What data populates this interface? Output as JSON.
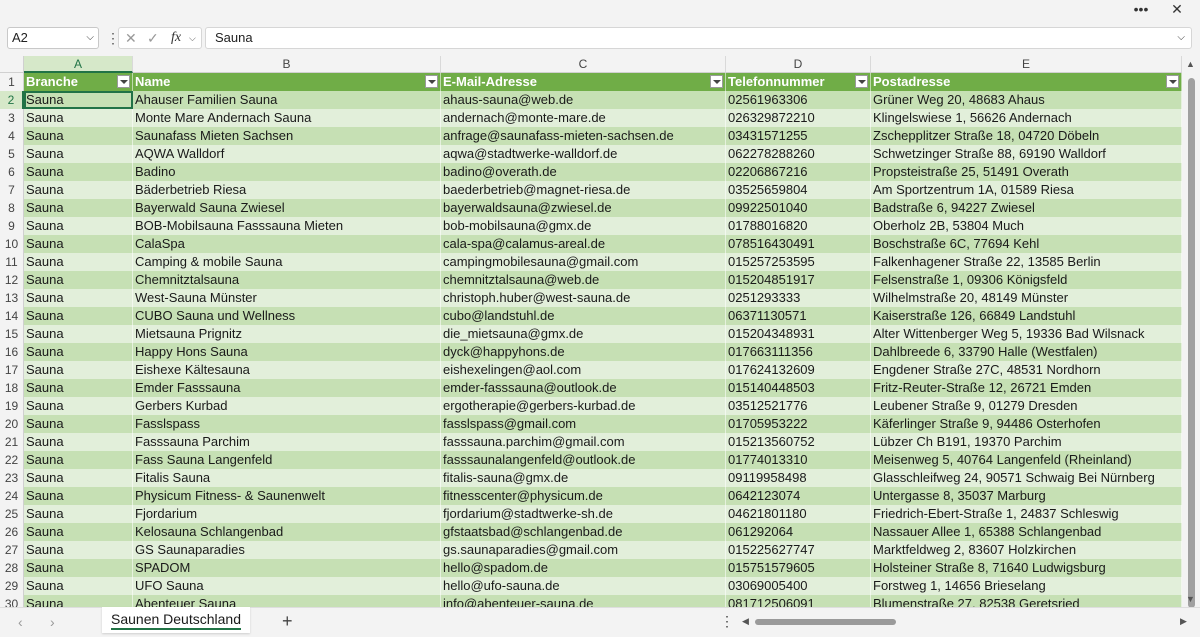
{
  "window": {
    "more_label": "•••",
    "close_label": "✕"
  },
  "formula_bar": {
    "name_box": "A2",
    "formula": "Sauna",
    "cancel_glyph": "✕",
    "enter_glyph": "✓",
    "fx_label": "fx"
  },
  "columns": [
    "A",
    "B",
    "C",
    "D",
    "E"
  ],
  "headers": [
    "Branche",
    "Name",
    "E-Mail-Adresse",
    "Telefonnummer",
    "Postadresse"
  ],
  "rows": [
    {
      "n": "2",
      "c": [
        "Sauna",
        "Ahauser Familien Sauna",
        "ahaus-sauna@web.de",
        "02561963306",
        "Grüner Weg 20, 48683 Ahaus"
      ]
    },
    {
      "n": "3",
      "c": [
        "Sauna",
        "Monte Mare Andernach Sauna",
        "andernach@monte-mare.de",
        "026329872210",
        "Klingelswiese 1, 56626 Andernach"
      ]
    },
    {
      "n": "4",
      "c": [
        "Sauna",
        "Saunafass Mieten Sachsen",
        "anfrage@saunafass-mieten-sachsen.de",
        "03431571255",
        "Zschepplitzer Straße 18, 04720 Döbeln"
      ]
    },
    {
      "n": "5",
      "c": [
        "Sauna",
        "AQWA Walldorf",
        "aqwa@stadtwerke-walldorf.de",
        "062278288260",
        "Schwetzinger Straße 88, 69190 Walldorf"
      ]
    },
    {
      "n": "6",
      "c": [
        "Sauna",
        "Badino",
        "badino@overath.de",
        "02206867216",
        "Propsteistraße 25, 51491 Overath"
      ]
    },
    {
      "n": "7",
      "c": [
        "Sauna",
        "Bäderbetrieb Riesa",
        "baederbetrieb@magnet-riesa.de",
        "03525659804",
        "Am Sportzentrum 1A, 01589 Riesa"
      ]
    },
    {
      "n": "8",
      "c": [
        "Sauna",
        "Bayerwald Sauna Zwiesel",
        "bayerwaldsauna@zwiesel.de",
        "09922501040",
        "Badstraße 6, 94227 Zwiesel"
      ]
    },
    {
      "n": "9",
      "c": [
        "Sauna",
        "BOB-Mobilsauna Fasssauna Mieten",
        "bob-mobilsauna@gmx.de",
        "01788016820",
        "Oberholz 2B, 53804 Much"
      ]
    },
    {
      "n": "10",
      "c": [
        "Sauna",
        "CalaSpa",
        "cala-spa@calamus-areal.de",
        "078516430491",
        "Boschstraße 6C, 77694 Kehl"
      ]
    },
    {
      "n": "11",
      "c": [
        "Sauna",
        "Camping & mobile Sauna",
        "campingmobilesauna@gmail.com",
        "015257253595",
        "Falkenhagener Straße 22, 13585 Berlin"
      ]
    },
    {
      "n": "12",
      "c": [
        "Sauna",
        "Chemnitztalsauna",
        "chemnitztalsauna@web.de",
        "015204851917",
        "Felsenstraße 1, 09306 Königsfeld"
      ]
    },
    {
      "n": "13",
      "c": [
        "Sauna",
        "West-Sauna Münster",
        "christoph.huber@west-sauna.de",
        "0251293333",
        "Wilhelmstraße 20, 48149 Münster"
      ]
    },
    {
      "n": "14",
      "c": [
        "Sauna",
        "CUBO Sauna und Wellness",
        "cubo@landstuhl.de",
        "06371130571",
        "Kaiserstraße 126, 66849 Landstuhl"
      ]
    },
    {
      "n": "15",
      "c": [
        "Sauna",
        "Mietsauna Prignitz",
        "die_mietsauna@gmx.de",
        "015204348931",
        "Alter Wittenberger Weg 5, 19336 Bad Wilsnack"
      ]
    },
    {
      "n": "16",
      "c": [
        "Sauna",
        "Happy Hons Sauna",
        "dyck@happyhons.de",
        "017663111356",
        "Dahlbreede 6, 33790 Halle (Westfalen)"
      ]
    },
    {
      "n": "17",
      "c": [
        "Sauna",
        "Eishexe Kältesauna",
        "eishexelingen@aol.com",
        "017624132609",
        "Engdener Straße 27C, 48531 Nordhorn"
      ]
    },
    {
      "n": "18",
      "c": [
        "Sauna",
        "Emder Fasssauna",
        "emder-fasssauna@outlook.de",
        "015140448503",
        "Fritz-Reuter-Straße 12, 26721 Emden"
      ]
    },
    {
      "n": "19",
      "c": [
        "Sauna",
        "Gerbers Kurbad",
        "ergotherapie@gerbers-kurbad.de",
        "03512521776",
        "Leubener Straße 9, 01279 Dresden"
      ]
    },
    {
      "n": "20",
      "c": [
        "Sauna",
        "Fasslspass",
        "fasslspass@gmail.com",
        "01705953222",
        "Käferlinger Straße 9, 94486 Osterhofen"
      ]
    },
    {
      "n": "21",
      "c": [
        "Sauna",
        "Fasssauna Parchim",
        "fasssauna.parchim@gmail.com",
        "015213560752",
        "Lübzer Ch B191, 19370 Parchim"
      ]
    },
    {
      "n": "22",
      "c": [
        "Sauna",
        "Fass Sauna Langenfeld",
        "fasssaunalangenfeld@outlook.de",
        "01774013310",
        "Meisenweg 5, 40764 Langenfeld (Rheinland)"
      ]
    },
    {
      "n": "23",
      "c": [
        "Sauna",
        "Fitalis Sauna",
        "fitalis-sauna@gmx.de",
        "09119958498",
        "Glasschleifweg 24, 90571 Schwaig Bei Nürnberg"
      ]
    },
    {
      "n": "24",
      "c": [
        "Sauna",
        "Physicum Fitness- & Saunenwelt",
        "fitnesscenter@physicum.de",
        "0642123074",
        "Untergasse 8, 35037 Marburg"
      ]
    },
    {
      "n": "25",
      "c": [
        "Sauna",
        "Fjordarium",
        "fjordarium@stadtwerke-sh.de",
        "04621801180",
        "Friedrich-Ebert-Straße 1, 24837 Schleswig"
      ]
    },
    {
      "n": "26",
      "c": [
        "Sauna",
        "Kelosauna Schlangenbad",
        "gfstaatsbad@schlangenbad.de",
        "061292064",
        "Nassauer Allee 1, 65388 Schlangenbad"
      ]
    },
    {
      "n": "27",
      "c": [
        "Sauna",
        "GS Saunaparadies",
        "gs.saunaparadies@gmail.com",
        "015225627747",
        "Marktfeldweg 2, 83607 Holzkirchen"
      ]
    },
    {
      "n": "28",
      "c": [
        "Sauna",
        "SPADOM",
        "hello@spadom.de",
        "015751579605",
        "Holsteiner Straße 8, 71640 Ludwigsburg"
      ]
    },
    {
      "n": "29",
      "c": [
        "Sauna",
        "UFO Sauna",
        "hello@ufo-sauna.de",
        "03069005400",
        "Forstweg 1, 14656 Brieselang"
      ]
    },
    {
      "n": "30",
      "c": [
        "Sauna",
        "Abenteuer Sauna",
        "info@abenteuer-sauna.de",
        "081712506091",
        "Blumenstraße 27, 82538 Geretsried"
      ]
    }
  ],
  "status_bar": {
    "sheet_tab": "Saunen Deutschland",
    "add_sheet": "+",
    "prev_sheet": "‹",
    "next_sheet": "›",
    "more": "⋮"
  }
}
